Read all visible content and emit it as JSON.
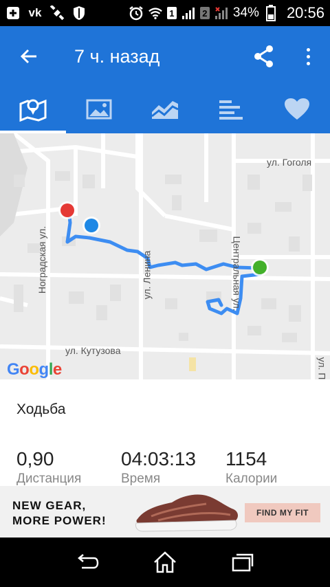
{
  "status_bar": {
    "battery_pct": "34%",
    "time": "20:56",
    "sim1": "1",
    "sim2": "2",
    "left_icons": [
      "plus-icon",
      "vk-icon",
      "satellite-icon",
      "shield-icon"
    ]
  },
  "app_bar": {
    "title": "7 ч. назад",
    "color": "#1f74d8"
  },
  "tabs": [
    {
      "icon": "map-icon",
      "active": true
    },
    {
      "icon": "photo-icon",
      "active": false
    },
    {
      "icon": "chart-icon",
      "active": false
    },
    {
      "icon": "splits-icon",
      "active": false
    },
    {
      "icon": "heart-icon",
      "active": false
    }
  ],
  "map": {
    "streets": [
      "ул. Гоголя",
      "Ноградская ул.",
      "ул. Ленина",
      "Центральная ул.",
      "ул. Кутузова",
      "ул. П"
    ],
    "attribution": "Google",
    "route_color": "#3d8df2",
    "start_marker_color": "#e53935",
    "end_marker_color": "#43b02a"
  },
  "summary": {
    "activity": "Ходьба",
    "stats": [
      {
        "value": "0,90",
        "label": "Дистанция"
      },
      {
        "value": "04:03:13",
        "label": "Время"
      },
      {
        "value": "1154",
        "label": "Калории"
      }
    ]
  },
  "ad": {
    "line1": "NEW GEAR,",
    "line2": "MORE POWER!",
    "cta": "FIND MY FIT"
  }
}
